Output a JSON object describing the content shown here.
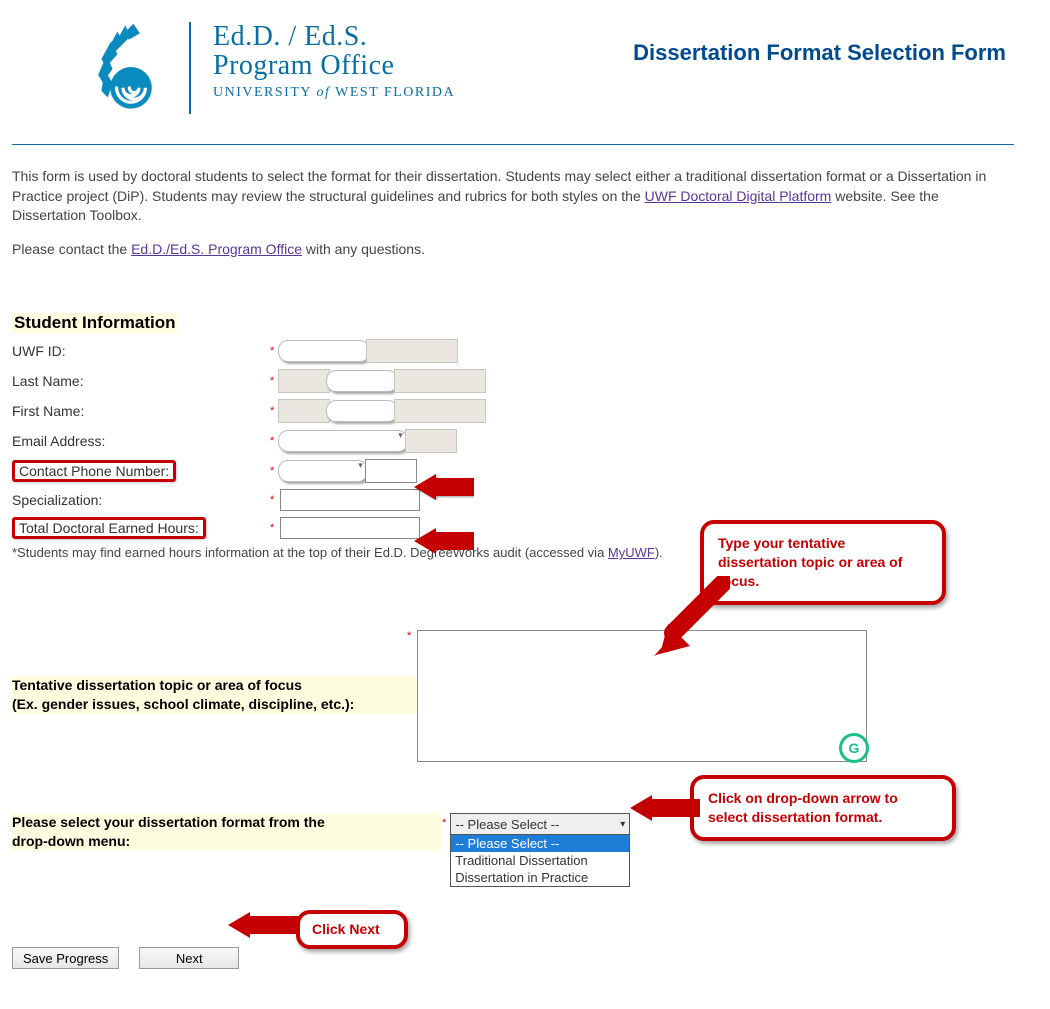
{
  "header": {
    "logo_line1": "Ed.D. / Ed.S.",
    "logo_line2": "Program Office",
    "logo_univ_pre": "UNIVERSITY ",
    "logo_univ_of": "of",
    "logo_univ_post": " WEST FLORIDA",
    "title": "Dissertation Format Selection Form"
  },
  "intro": {
    "p1a": "This form is used by doctoral students to select the format for their dissertation. Students may select either a traditional dissertation format or a Dissertation in Practice project (DiP). Students may review the structural guidelines and rubrics for both styles on the ",
    "link1": "UWF Doctoral Digital Platform",
    "p1b": " website. See the Dissertation Toolbox.",
    "p2a": "Please contact the ",
    "link2": "Ed.D./Ed.S. Program Office",
    "p2b": " with any questions."
  },
  "section1_title": "Student Information",
  "fields": {
    "uwf_id": "UWF ID:",
    "last_name": "Last Name:",
    "first_name": "First Name:",
    "email": "Email Address:",
    "phone": "Contact Phone Number:",
    "specialization": "Specialization:",
    "hours": "Total Doctoral Earned Hours:"
  },
  "footnote": {
    "text_a": "*Students may find earned hours information at the top of their Ed.D. DegreeWorks audit (accessed via ",
    "link": "MyUWF",
    "text_b": ")."
  },
  "topic": {
    "label_line1": "Tentative dissertation topic or area of focus",
    "label_line2": " (Ex. gender issues, school climate, discipline, etc.):"
  },
  "format": {
    "label_line1": "Please select your dissertation format from the",
    "label_line2": "drop-down menu:",
    "selected": "-- Please Select --",
    "options": [
      "-- Please Select --",
      "Traditional Dissertation",
      "Dissertation in Practice"
    ]
  },
  "callouts": {
    "c1": "Type your tentative dissertation topic or area of focus.",
    "c2": "Click on drop-down arrow to select dissertation format.",
    "c3": "Click Next"
  },
  "buttons": {
    "save": "Save Progress",
    "next": "Next"
  },
  "grammarly_glyph": "G"
}
